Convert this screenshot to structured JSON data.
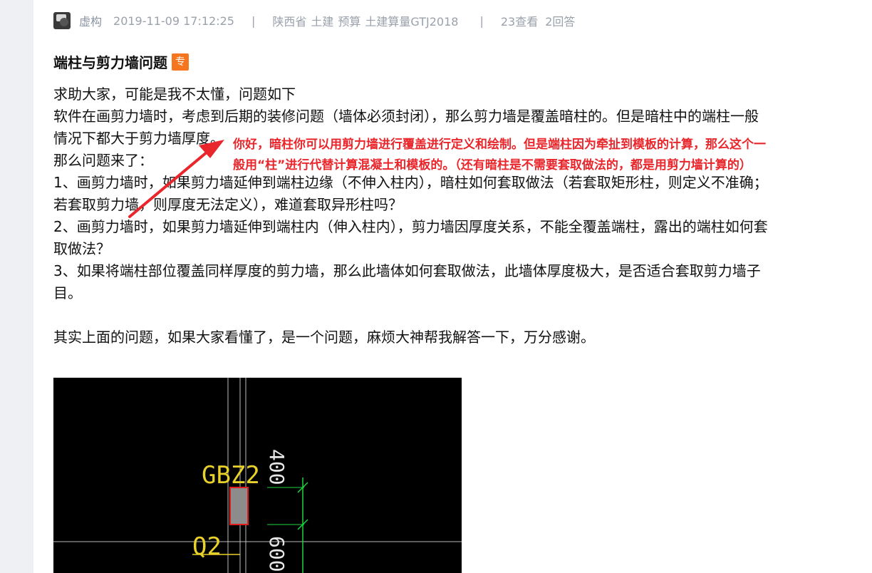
{
  "meta": {
    "author": "虚构",
    "datetime": "2019-11-09 17:12:25",
    "separator": "|",
    "tags": [
      "陕西省",
      "土建",
      "预算",
      "土建算量GTJ2018"
    ],
    "views": "23查看",
    "answers": "2回答"
  },
  "question": {
    "title": "端柱与剪力墙问题",
    "badge": "专",
    "lines": [
      "求助大家，可能是我不太懂，问题如下",
      "软件在画剪力墙时，考虑到后期的装修问题（墙体必须封闭），那么剪力墙是覆盖暗柱的。但是暗柱中的端柱一般",
      "情况下都大于剪力墙厚度。",
      "那么问题来了：",
      "1、画剪力墙时，如果剪力墙延伸到端柱边缘（不伸入柱内），暗柱如何套取做法（若套取矩形柱，则定义不准确；",
      "若套取剪力墙，则厚度无法定义），难道套取异形柱吗？",
      "2、画剪力墙时，如果剪力墙延伸到端柱内（伸入柱内），剪力墙因厚度关系，不能全覆盖端柱，露出的端柱如何套",
      "取做法？",
      "3、如果将端柱部位覆盖同样厚度的剪力墙，那么此墙体如何套取做法，此墙体厚度极大，是否适合套取剪力墙子",
      "目。",
      "其实上面的问题，如果大家看懂了，是一个问题，麻烦大神帮我解答一下，万分感谢。"
    ]
  },
  "annotation": {
    "line1": "你好，暗柱你可以用剪力墙进行覆盖进行定义和绘制。但是端柱因为牵扯到模板的计算，那么这个一",
    "line2": "般用“柱”进行代替计算混凝土和模板的。（还有暗柱是不需要套取做法的，都是用剪力墙计算的）",
    "color": "#e8262b"
  },
  "cad": {
    "label_gbz": "GBZ2",
    "label_q": "Q2",
    "dim_top": "400",
    "dim_bottom": "600"
  }
}
